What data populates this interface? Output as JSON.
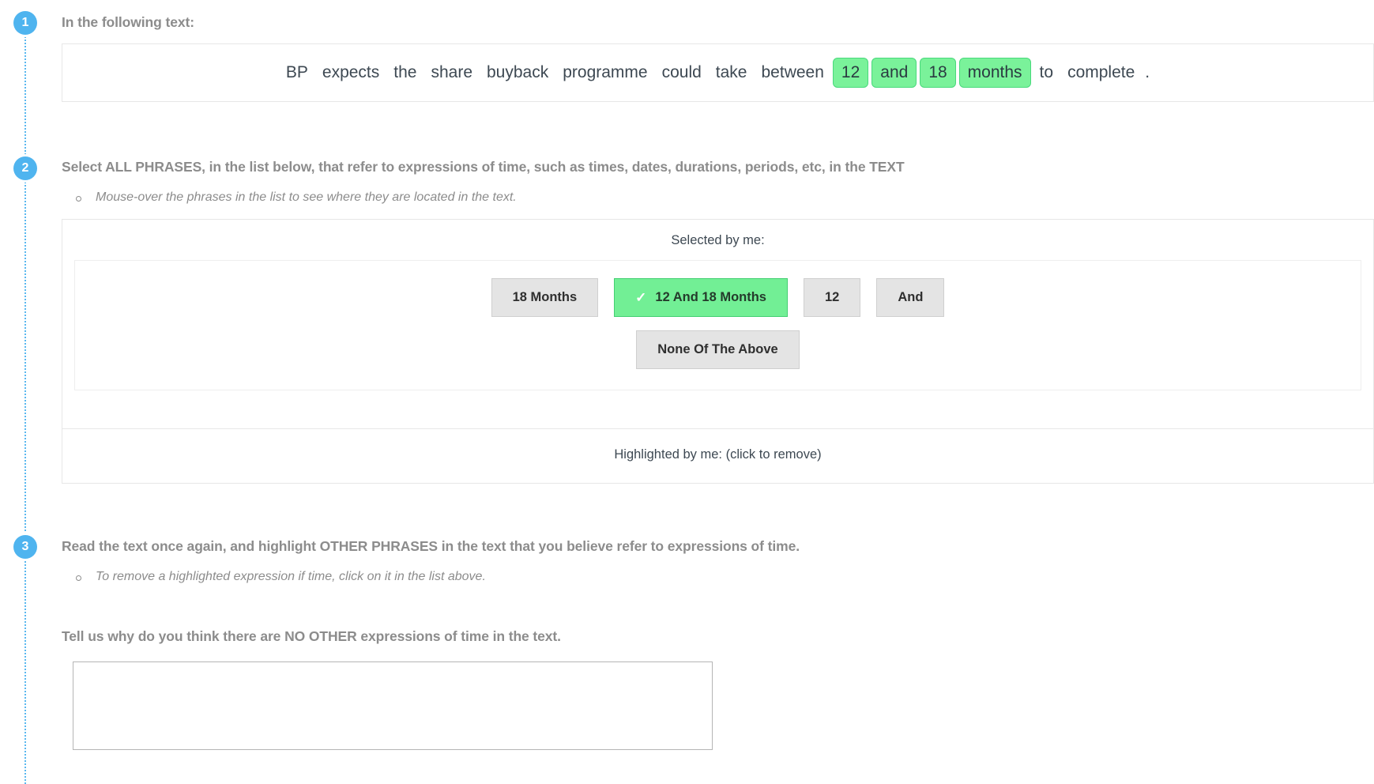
{
  "steps": {
    "one": "1",
    "two": "2",
    "three": "3"
  },
  "section1": {
    "heading": "In the following text:",
    "tokens": [
      {
        "text": "BP",
        "highlighted": false
      },
      {
        "text": "expects",
        "highlighted": false
      },
      {
        "text": "the",
        "highlighted": false
      },
      {
        "text": "share",
        "highlighted": false
      },
      {
        "text": "buyback",
        "highlighted": false
      },
      {
        "text": "programme",
        "highlighted": false
      },
      {
        "text": "could",
        "highlighted": false
      },
      {
        "text": "take",
        "highlighted": false
      },
      {
        "text": "between",
        "highlighted": false
      },
      {
        "text": "12",
        "highlighted": true
      },
      {
        "text": "and",
        "highlighted": true
      },
      {
        "text": "18",
        "highlighted": true
      },
      {
        "text": "months",
        "highlighted": true
      },
      {
        "text": "to",
        "highlighted": false
      },
      {
        "text": "complete",
        "highlighted": false
      },
      {
        "text": ".",
        "highlighted": false
      }
    ]
  },
  "section2": {
    "heading": "Select ALL PHRASES, in the list below, that refer to expressions of time, such as times, dates, durations, periods, etc, in the TEXT",
    "hint": "Mouse-over the phrases in the list to see where they are located in the text.",
    "selected_by_me_label": "Selected by me:",
    "highlighted_by_me_label": "Highlighted by me: (click to remove)",
    "check_glyph": "✓",
    "chips_row1": [
      {
        "label": "18 Months",
        "selected": false
      },
      {
        "label": "12 And 18 Months",
        "selected": true
      },
      {
        "label": "12",
        "selected": false
      },
      {
        "label": "And",
        "selected": false
      }
    ],
    "chips_row2": [
      {
        "label": "None Of The Above",
        "selected": false
      }
    ]
  },
  "section3": {
    "heading": "Read the text once again, and highlight OTHER PHRASES in the text that you believe refer to expressions of time.",
    "hint": "To remove a highlighted expression if time, click on it in the list above.",
    "question": "Tell us why do you think there are NO OTHER expressions of time in the text.",
    "answer_value": "",
    "answer_placeholder": ""
  },
  "colors": {
    "accent_blue": "#4fb4ef",
    "highlight_green": "#7af29a",
    "chip_gray": "#e4e4e4",
    "heading_gray": "#8c8c8c"
  }
}
